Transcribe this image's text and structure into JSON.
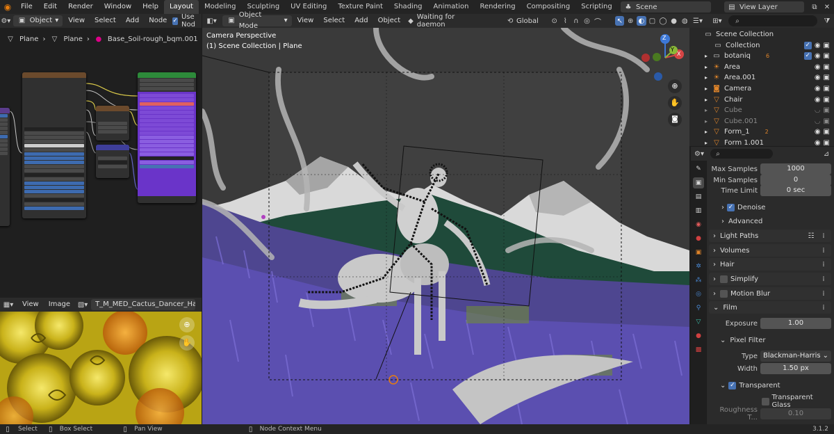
{
  "topbar": {
    "menus": [
      "File",
      "Edit",
      "Render",
      "Window",
      "Help"
    ],
    "workspaces": [
      "Layout",
      "Modeling",
      "Sculpting",
      "UV Editing",
      "Texture Paint",
      "Shading",
      "Animation",
      "Rendering",
      "Compositing",
      "Scripting"
    ],
    "active_workspace": "Layout",
    "add_tab": "+",
    "scene": "Scene",
    "view_layer": "View Layer"
  },
  "node_editor": {
    "mode": "Object",
    "menus": [
      "View",
      "Select",
      "Add",
      "Node"
    ],
    "use_nodes": "Use Nod",
    "breadcrumb": [
      "Plane",
      "Plane",
      "Base_Soil-rough_bqm.001"
    ]
  },
  "image_editor": {
    "menus": [
      "View",
      "Image"
    ],
    "image_name": "T_M_MED_Cactus_Dancer_Hair_M.tg"
  },
  "viewport": {
    "mode": "Object Mode",
    "menus": [
      "View",
      "Select",
      "Add",
      "Object"
    ],
    "status": "Waiting for daemon",
    "orientation": "Global",
    "overlay_title": "Camera Perspective",
    "overlay_sub": "(1) Scene Collection | Plane",
    "gizmo": {
      "z": "Z",
      "y": "Y",
      "x": "X"
    }
  },
  "outliner": {
    "root": "Scene Collection",
    "items": [
      {
        "name": "Collection",
        "dim": false
      },
      {
        "name": "botaniq",
        "dim": false,
        "extra": "6"
      },
      {
        "name": "Area",
        "dim": false
      },
      {
        "name": "Area.001",
        "dim": false
      },
      {
        "name": "Camera",
        "dim": false
      },
      {
        "name": "Chair",
        "dim": false
      },
      {
        "name": "Cube",
        "dim": true
      },
      {
        "name": "Cube.001",
        "dim": true
      },
      {
        "name": "Form_1",
        "dim": false,
        "extra": "2"
      },
      {
        "name": "Form 1.001",
        "dim": false
      }
    ]
  },
  "properties": {
    "max_samples_label": "Max Samples",
    "max_samples": "1000",
    "min_samples_label": "Min Samples",
    "min_samples": "0",
    "time_limit_label": "Time Limit",
    "time_limit": "0 sec",
    "denoise": "Denoise",
    "advanced": "Advanced",
    "panels": [
      "Light Paths",
      "Volumes",
      "Hair",
      "Simplify",
      "Motion Blur",
      "Film"
    ],
    "exposure_label": "Exposure",
    "exposure": "1.00",
    "pixel_filter": "Pixel Filter",
    "type_label": "Type",
    "type": "Blackman-Harris",
    "width_label": "Width",
    "width": "1.50 px",
    "transparent": "Transparent",
    "transparent_glass": "Transparent Glass",
    "roughness_label": "Roughness T...",
    "roughness": "0.10"
  },
  "statusbar": {
    "select": "Select",
    "box_select": "Box Select",
    "pan_view": "Pan View",
    "context_menu": "Node Context Menu",
    "version": "3.1.2"
  },
  "colors": {
    "accent": "#4772b3",
    "workspace_active": "#3d3d3d",
    "lavender": "#5b4fb0",
    "sky": "#3a3a3a",
    "node_principled": "#6a34c9"
  }
}
